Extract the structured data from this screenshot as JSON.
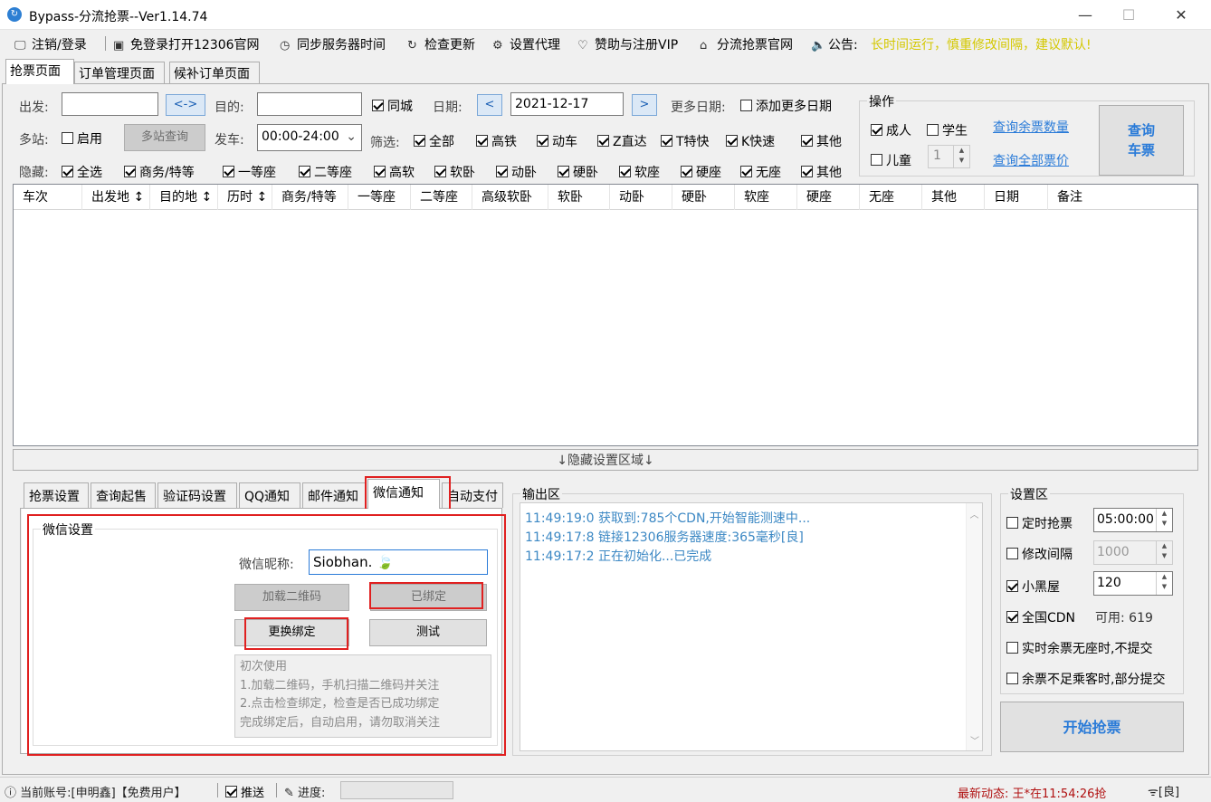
{
  "window": {
    "title": "Bypass-分流抢票--Ver1.14.74",
    "minimize": "—",
    "maximize": "☐",
    "close": "✕"
  },
  "menu": [
    {
      "icon": "🖵",
      "label": "注销/登录"
    },
    {
      "icon": "▣",
      "label": "免登录打开12306官网"
    },
    {
      "icon": "◷",
      "label": "同步服务器时间"
    },
    {
      "icon": "↻",
      "label": "检查更新"
    },
    {
      "icon": "⚙",
      "label": "设置代理"
    },
    {
      "icon": "♡",
      "label": "赞助与注册VIP"
    },
    {
      "icon": "⌂",
      "label": "分流抢票官网"
    },
    {
      "icon": "🔈",
      "label": "公告:"
    }
  ],
  "notice": "长时间运行，慎重修改间隔，建议默认!",
  "main_tabs": [
    "抢票页面",
    "订单管理页面",
    "候补订单页面"
  ],
  "query": {
    "from_label": "出发:",
    "swap": "<->",
    "to_label": "目的:",
    "same_city": "同城",
    "date_label": "日期:",
    "prev": "<",
    "date": "2021-12-17",
    "next": ">",
    "more_dates_label": "更多日期:",
    "add_more_dates": "添加更多日期",
    "multi_label": "多站:",
    "enable": "启用",
    "multi_query": "多站查询",
    "depart_label": "发车:",
    "time_range": "00:00-24:00",
    "filter_label": "筛选:",
    "filters": [
      "全部",
      "高铁",
      "动车",
      "Z直达",
      "T特快",
      "K快速",
      "其他"
    ],
    "hide_label": "隐藏:",
    "hides": [
      "全选",
      "商务/特等",
      "一等座",
      "二等座",
      "高软",
      "软卧",
      "动卧",
      "硬卧",
      "软座",
      "硬座",
      "无座",
      "其他"
    ]
  },
  "ops": {
    "title": "操作",
    "adult": "成人",
    "student": "学生",
    "child": "儿童",
    "child_count": "1",
    "query_remaining": "查询余票数量",
    "query_prices": "查询全部票价",
    "query_btn_1": "查询",
    "query_btn_2": "车票"
  },
  "grid_headers": [
    "车次",
    "出发地 ↕",
    "目的地 ↕",
    "历时 ↕",
    "商务/特等",
    "一等座",
    "二等座",
    "高级软卧",
    "软卧",
    "动卧",
    "硬卧",
    "软座",
    "硬座",
    "无座",
    "其他",
    "日期",
    "备注"
  ],
  "splitter": "↓隐藏设置区域↓",
  "settings_tabs": [
    "抢票设置",
    "查询起售",
    "验证码设置",
    "QQ通知",
    "邮件通知",
    "微信通知",
    "自动支付"
  ],
  "wechat": {
    "group_title": "微信设置",
    "nickname_label": "微信昵称:",
    "nickname": "Siobhan. 🍃",
    "load_qr": "加载二维码",
    "bound": "已绑定",
    "rebind": "更换绑定",
    "test": "测试",
    "help": [
      "初次使用",
      "1.加载二维码，手机扫描二维码并关注",
      "2.点击检查绑定，检查是否已成功绑定",
      "完成绑定后，自动启用，请勿取消关注"
    ]
  },
  "output": {
    "title": "输出区",
    "lines": [
      "11:49:19:0   获取到:785个CDN,开始智能测速中...",
      "11:49:17:8   链接12306服务器速度:365毫秒[良]",
      "11:49:17:2   正在初始化...已完成"
    ]
  },
  "settings": {
    "title": "设置区",
    "timed": "定时抢票",
    "timed_value": "05:00:00",
    "interval": "修改间隔",
    "interval_value": "1000",
    "blackroom": "小黑屋",
    "blackroom_value": "120",
    "cdn": "全国CDN",
    "cdn_available": "可用: 619",
    "no_seat": "实时余票无座时,不提交",
    "partial": "余票不足乘客时,部分提交",
    "start": "开始抢票"
  },
  "status": {
    "account": "当前账号:[申明鑫]【免费用户】",
    "push": "推送",
    "progress": "进度:",
    "news": "最新动态: 王*在11:54:26抢",
    "signal": "[良]"
  }
}
